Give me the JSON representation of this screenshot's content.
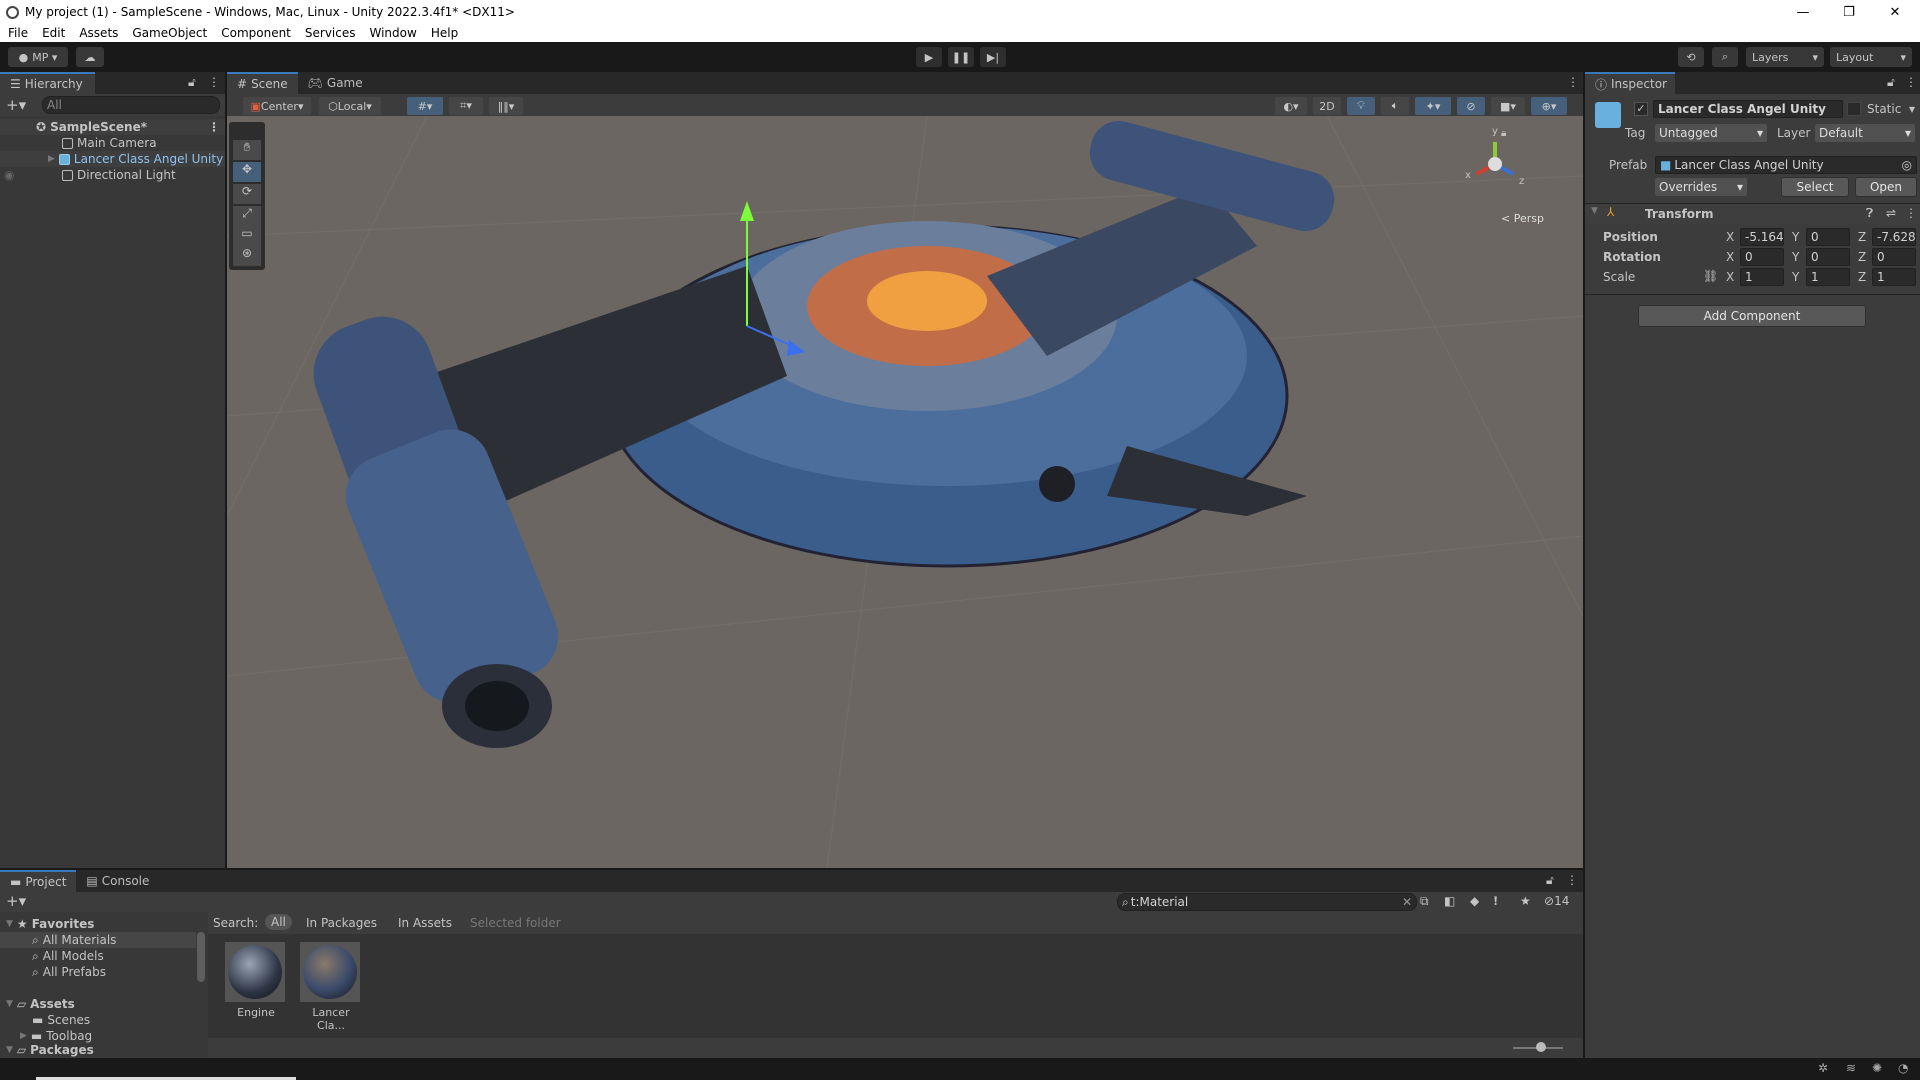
{
  "window": {
    "title": "My project (1) - SampleScene - Windows, Mac, Linux - Unity 2022.3.4f1* <DX11>",
    "minimize": "—",
    "restore": "❐",
    "close": "✕"
  },
  "menu": [
    "File",
    "Edit",
    "Assets",
    "GameObject",
    "Component",
    "Services",
    "Window",
    "Help"
  ],
  "toolbar": {
    "account": "MP",
    "layers": "Layers",
    "layout": "Layout"
  },
  "hierarchy": {
    "tab": "Hierarchy",
    "search_placeholder": "All",
    "scene": "SampleScene*",
    "items": [
      "Main Camera",
      "Lancer Class Angel Unity",
      "Directional Light"
    ]
  },
  "scene": {
    "tabs": [
      "Scene",
      "Game"
    ],
    "pivot": "Center",
    "space": "Local",
    "mode_2d": "2D",
    "persp": "Persp",
    "gizmo": {
      "y": "y",
      "x": "x",
      "z": "z"
    }
  },
  "inspector": {
    "tab": "Inspector",
    "object_name": "Lancer Class Angel Unity",
    "active": true,
    "static_label": "Static",
    "tag_label": "Tag",
    "tag": "Untagged",
    "layer_label": "Layer",
    "layer": "Default",
    "prefab_label": "Prefab",
    "prefab": "Lancer Class Angel Unity",
    "overrides": "Overrides",
    "select": "Select",
    "open": "Open",
    "transform": {
      "title": "Transform",
      "rows": [
        {
          "label": "Position",
          "x": "-5.164",
          "y": "0",
          "z": "-7.628"
        },
        {
          "label": "Rotation",
          "x": "0",
          "y": "0",
          "z": "0"
        },
        {
          "label": "Scale",
          "x": "1",
          "y": "1",
          "z": "1"
        }
      ],
      "axes": [
        "X",
        "Y",
        "Z"
      ]
    },
    "add_component": "Add Component"
  },
  "project": {
    "tabs": [
      "Project",
      "Console"
    ],
    "search_value": "t:Material",
    "hidden_count": "14",
    "search_label": "Search:",
    "scopes": [
      "All",
      "In Packages",
      "In Assets",
      "Selected folder"
    ],
    "favorites": {
      "label": "Favorites",
      "items": [
        "All Materials",
        "All Models",
        "All Prefabs"
      ]
    },
    "assets": {
      "label": "Assets",
      "items": [
        "Scenes",
        "Toolbag"
      ]
    },
    "packages": {
      "label": "Packages"
    },
    "materials": [
      {
        "name": "Engine"
      },
      {
        "name": "Lancer Cla..."
      }
    ],
    "zoom_level": 0.55
  },
  "colors": {
    "accent": "#3a79bb",
    "scene_bg": "#6b6661",
    "panel": "#383838"
  }
}
